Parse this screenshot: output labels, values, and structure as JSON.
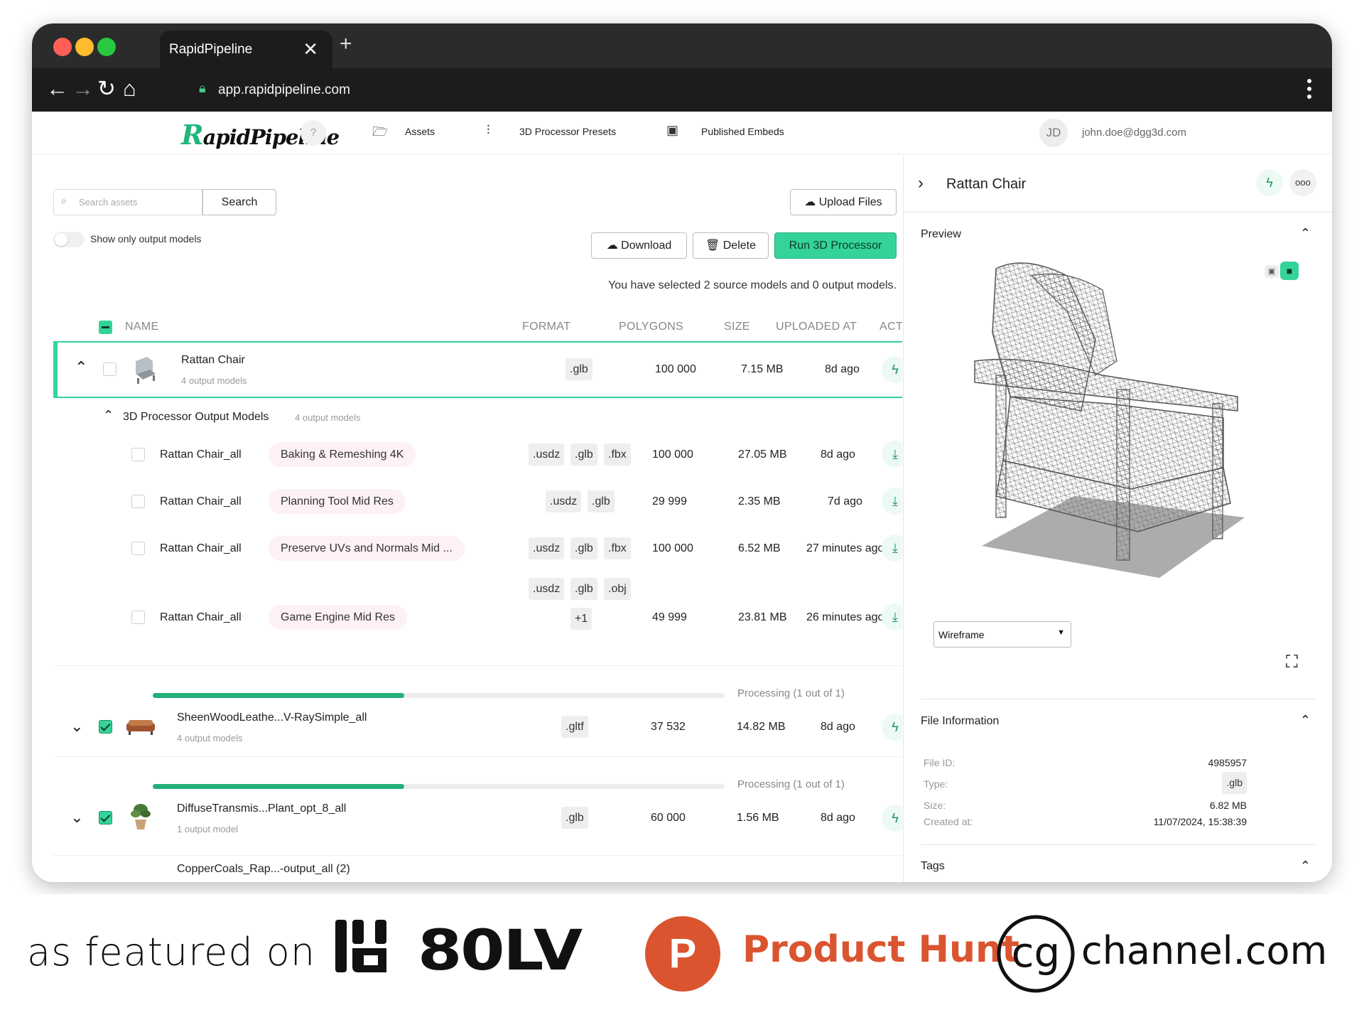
{
  "browser": {
    "tab_title": "RapidPipeline",
    "tab_close": "✕",
    "new_tab": "+",
    "url": "app.rapidpipeline.com"
  },
  "header": {
    "logo_initial": "R",
    "logo_rest": "apidPipeline",
    "help": "?",
    "nav": [
      "Assets",
      "3D Processor Presets",
      "Published Embeds"
    ],
    "avatar_initials": "JD",
    "email": "john.doe@dgg3d.com"
  },
  "toolbar": {
    "search_placeholder": "Search assets",
    "search_button": "Search",
    "upload_button": "Upload Files",
    "toggle_label": "Show only output models",
    "download_button": "Download",
    "delete_button": "Delete",
    "run_button": "Run 3D Processor",
    "selection_info": "You have selected 2 source models and 0 output models."
  },
  "table": {
    "columns": [
      "NAME",
      "FORMAT",
      "POLYGONS",
      "SIZE",
      "UPLOADED AT",
      "ACT"
    ],
    "rows": [
      {
        "name": "Rattan Chair",
        "outputs": "4 output models",
        "formats": [
          ".glb"
        ],
        "polygons": "100 000",
        "size": "7.15 MB",
        "uploaded": "8d ago",
        "checked": false,
        "expanded": true
      },
      {
        "name": "SheenWoodLeathe...V-RaySimple_all",
        "outputs": "4 output models",
        "formats": [
          ".gltf"
        ],
        "polygons": "37 532",
        "size": "14.82 MB",
        "uploaded": "8d ago",
        "checked": true,
        "expanded": false,
        "processing": "Processing (1 out of 1)",
        "progress": 0.44
      },
      {
        "name": "DiffuseTransmis...Plant_opt_8_all",
        "outputs": "1 output model",
        "formats": [
          ".glb"
        ],
        "polygons": "60 000",
        "size": "1.56 MB",
        "uploaded": "8d ago",
        "checked": true,
        "expanded": false,
        "processing": "Processing (1 out of 1)",
        "progress": 0.44
      },
      {
        "name": "CopperCoals_Rap...-output_all (2)"
      }
    ],
    "output_group": {
      "title": "3D Processor Output Models",
      "count": "4 output models",
      "items": [
        {
          "name": "Rattan Chair_all",
          "preset": "Baking & Remeshing 4K",
          "formats": [
            ".usdz",
            ".glb",
            ".fbx"
          ],
          "polygons": "100 000",
          "size": "27.05 MB",
          "uploaded": "8d ago"
        },
        {
          "name": "Rattan Chair_all",
          "preset": "Planning Tool Mid Res",
          "formats": [
            ".usdz",
            ".glb"
          ],
          "polygons": "29 999",
          "size": "2.35 MB",
          "uploaded": "7d ago"
        },
        {
          "name": "Rattan Chair_all",
          "preset": "Preserve UVs and Normals Mid ...",
          "formats": [
            ".usdz",
            ".glb",
            ".fbx"
          ],
          "polygons": "100 000",
          "size": "6.52 MB",
          "uploaded": "27 minutes ago"
        },
        {
          "name": "Rattan Chair_all",
          "preset": "Game Engine Mid Res",
          "formats": [
            ".usdz",
            ".glb",
            ".obj"
          ],
          "extra_formats": "+1",
          "polygons": "49 999",
          "size": "23.81 MB",
          "uploaded": "26 minutes ago"
        }
      ]
    }
  },
  "panel": {
    "title": "Rattan Chair",
    "preview_label": "Preview",
    "render_mode": "Wireframe",
    "file_info_label": "File Information",
    "file_info": [
      {
        "key": "File ID:",
        "value": "4985957"
      },
      {
        "key": "Type:",
        "value": ".glb"
      },
      {
        "key": "Size:",
        "value": "6.82 MB"
      },
      {
        "key": "Created at:",
        "value": "11/07/2024, 15:38:39"
      }
    ],
    "tags_label": "Tags"
  },
  "featured": {
    "label": "as featured on",
    "logos": [
      "80LV",
      "Product Hunt",
      "channel.com"
    ],
    "cg_mark": "cg",
    "ph_mark": "P"
  },
  "colors": {
    "accent": "#34d399",
    "accent_dark": "#22b07a",
    "product_hunt": "#da552f"
  }
}
